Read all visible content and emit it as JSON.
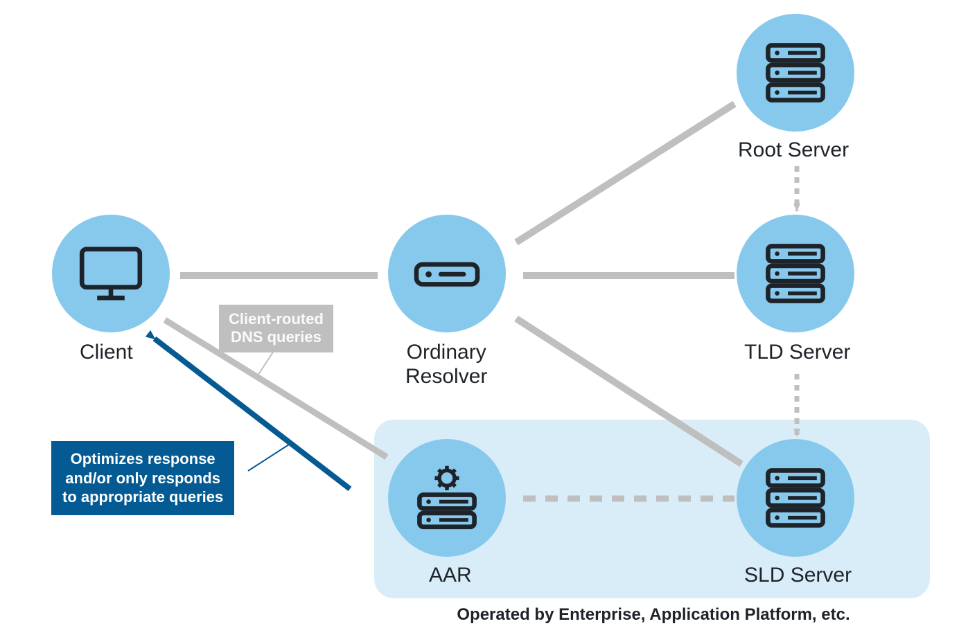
{
  "nodes": {
    "client": {
      "label": "Client"
    },
    "resolver": {
      "label": "Ordinary\nResolver"
    },
    "root": {
      "label": "Root Server"
    },
    "tld": {
      "label": "TLD Server"
    },
    "sld": {
      "label": "SLD Server"
    },
    "aar": {
      "label": "AAR"
    }
  },
  "callouts": {
    "client_routed": "Client-routed\nDNS queries",
    "optimizes": "Optimizes response\nand/or only responds\nto appropriate queries"
  },
  "region_caption": "Operated by Enterprise, Application Platform, etc."
}
